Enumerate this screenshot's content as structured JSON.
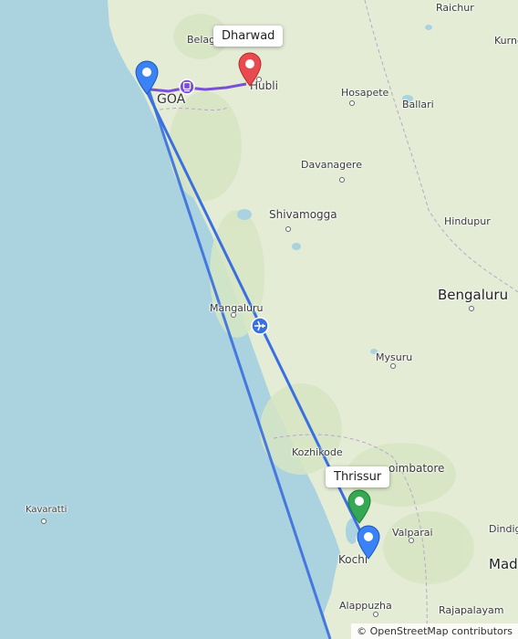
{
  "map": {
    "places": {
      "raichur": "Raichur",
      "kurnool": "Kurno",
      "belagavi": "Belag",
      "goa": "GOA",
      "hubli": "Hubli",
      "hosapete": "Hosapete",
      "ballari": "Ballari",
      "davanagere": "Davanagere",
      "shivamogga": "Shivamogga",
      "hindupur": "Hindupur",
      "bengaluru": "Bengaluru",
      "mangaluru": "Mangaluru",
      "mysuru": "Mysuru",
      "kozhikode": "Kozhikode",
      "coimbatore": "oimbatore",
      "kavaratti": "Kavaratti",
      "valparai": "Valparai",
      "dindigul": "Dindig",
      "kochi": "Kochi",
      "madurai": "Mad",
      "alappuzha": "Alappuzha",
      "rajapalayam": "Rajapalayam"
    },
    "callouts": {
      "dharwad": "Dharwad",
      "thrissur": "Thrissur"
    },
    "attribution": "© OpenStreetMap contributors",
    "colors": {
      "sea": "#aad3df",
      "land": "#e4ecd6",
      "flight_route": "#3a6fe0",
      "rail_route": "#7a4fd8",
      "destination_pin": "#e84a4f",
      "origin_pin": "#3b82f6",
      "waypoint_pin": "#34a853"
    },
    "icons": {
      "airport": "airplane-icon",
      "rail": "train-icon",
      "station": "station-icon"
    }
  }
}
